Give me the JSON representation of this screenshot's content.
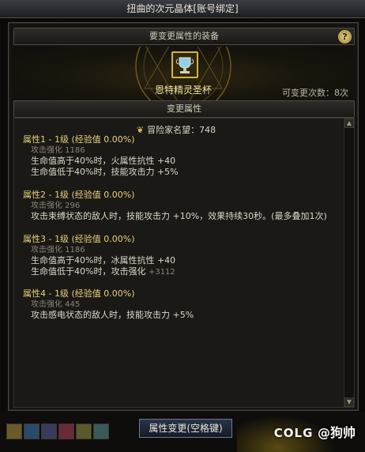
{
  "window": {
    "title": "扭曲的次元晶体[账号绑定]"
  },
  "equip_section": {
    "header": "要变更属性的装备",
    "help_label": "?",
    "item_name": "恩特精灵圣杯",
    "change_count": "可变更次数：8次"
  },
  "change_section": {
    "header": "变更属性",
    "fame": "冒险家名望：748"
  },
  "properties": [
    {
      "title": "属性1 - 1级 (经验值 0.00%)",
      "attack": "攻击强化 1186",
      "lines": [
        "生命值高于40%时，火属性抗性 +40",
        "生命值低于40%时，技能攻击力 +5%"
      ],
      "extra": ""
    },
    {
      "title": "属性2 - 1级 (经验值 0.00%)",
      "attack": "攻击强化 296",
      "lines": [
        "攻击束缚状态的敌人时，技能攻击力 +10%，效果持续30秒。(最多叠加1次)"
      ],
      "extra": ""
    },
    {
      "title": "属性3 - 1级 (经验值 0.00%)",
      "attack": "攻击强化 1186",
      "lines": [
        "生命值高于40%时，冰属性抗性 +40",
        "生命值低于40%时，攻击强化"
      ],
      "extra": "+3112"
    },
    {
      "title": "属性4 - 1级 (经验值 0.00%)",
      "attack": "攻击强化 445",
      "lines": [
        "攻击感电状态的敌人时，技能攻击力 +5%"
      ],
      "extra": ""
    }
  ],
  "footer": {
    "confirm_button": "属性变更(空格键)",
    "watermark_logo": "COLG",
    "watermark_text": "@狗帅"
  },
  "colors": {
    "title_gold": "#e7cf7a",
    "item_name": "#f0e4a6",
    "muted": "#8b8577"
  },
  "icons": {
    "item": "grail-icon",
    "fame": "fame-crest-icon"
  }
}
